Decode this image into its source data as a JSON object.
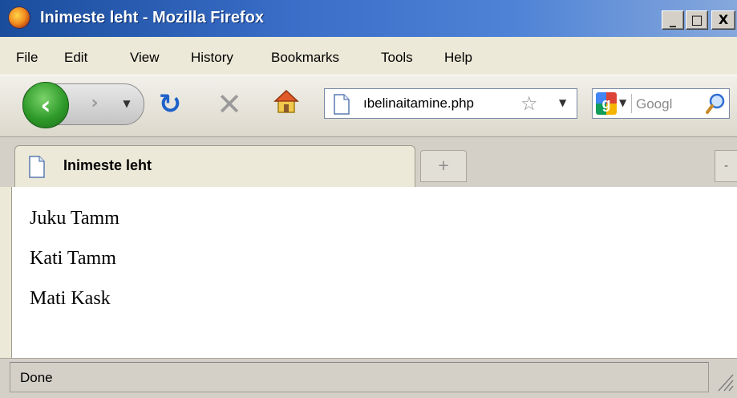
{
  "window": {
    "title": "Inimeste leht - Mozilla Firefox",
    "buttons": {
      "minimize": "_",
      "maximize": "□",
      "close": "X"
    }
  },
  "menu": {
    "items": [
      "File",
      "Edit",
      "View",
      "History",
      "Bookmarks",
      "Tools",
      "Help"
    ]
  },
  "toolbar": {
    "url": "ıbelinaitamine.php",
    "search_placeholder": "Googl",
    "back_icon": "back-arrow-icon",
    "reload_icon": "reload-icon",
    "stop_icon": "stop-icon",
    "home_icon": "home-icon"
  },
  "tabs": {
    "active": "Inimeste leht"
  },
  "content": {
    "people": [
      "Juku Tamm",
      "Kati Tamm",
      "Mati Kask"
    ]
  },
  "status": {
    "text": "Done"
  },
  "colors": {
    "titlebar_start": "#1a4d9c",
    "titlebar_end": "#86a8dc",
    "reload_blue": "#1e62c9",
    "back_green": "#2f9a2a",
    "chrome_bg": "#ece9d8"
  }
}
